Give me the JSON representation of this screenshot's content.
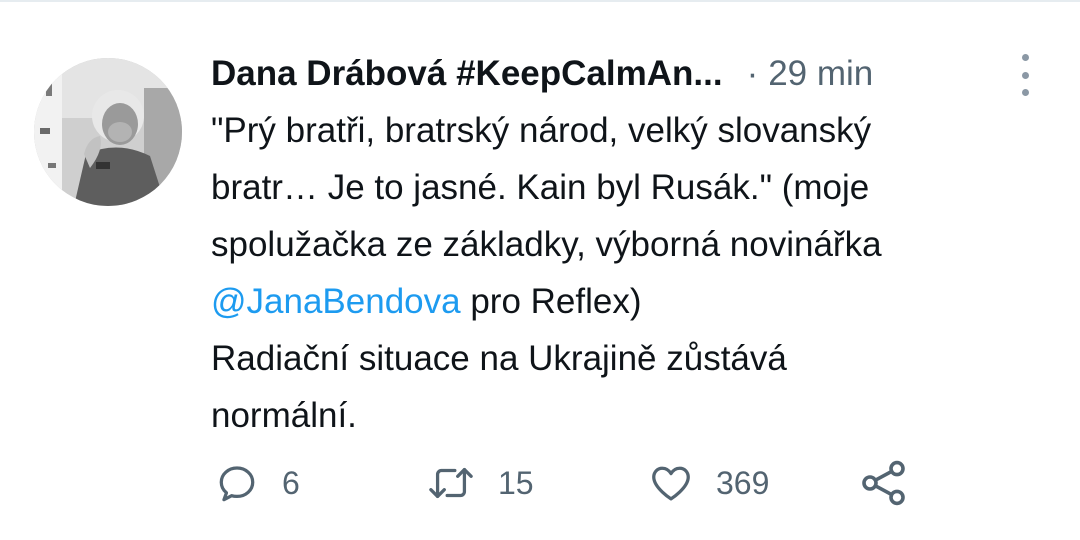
{
  "tweet": {
    "author": {
      "display_name": "Dana Drábová #KeepCalmAn..."
    },
    "separator": "·",
    "timestamp": "29 min",
    "text_lines": [
      "\"Prý bratři, bratrský národ, velký slovanský",
      "bratr… Je to jasné. Kain byl Rusák.\" (moje",
      "spolužačka ze základky, výborná novinářka"
    ],
    "mention": "@JanaBendova",
    "after_mention": " pro Reflex)",
    "text_lines_2": [
      "Radiační situace na Ukrajině zůstává",
      "normální."
    ]
  },
  "actions": {
    "reply": {
      "icon": "reply-icon",
      "count": "6"
    },
    "retweet": {
      "icon": "retweet-icon",
      "count": "15"
    },
    "like": {
      "icon": "heart-icon",
      "count": "369"
    },
    "share": {
      "icon": "share-icon"
    }
  },
  "colors": {
    "text": "#0f1419",
    "muted": "#536471",
    "link": "#1d9bf0",
    "divider": "#e6ecf0"
  }
}
